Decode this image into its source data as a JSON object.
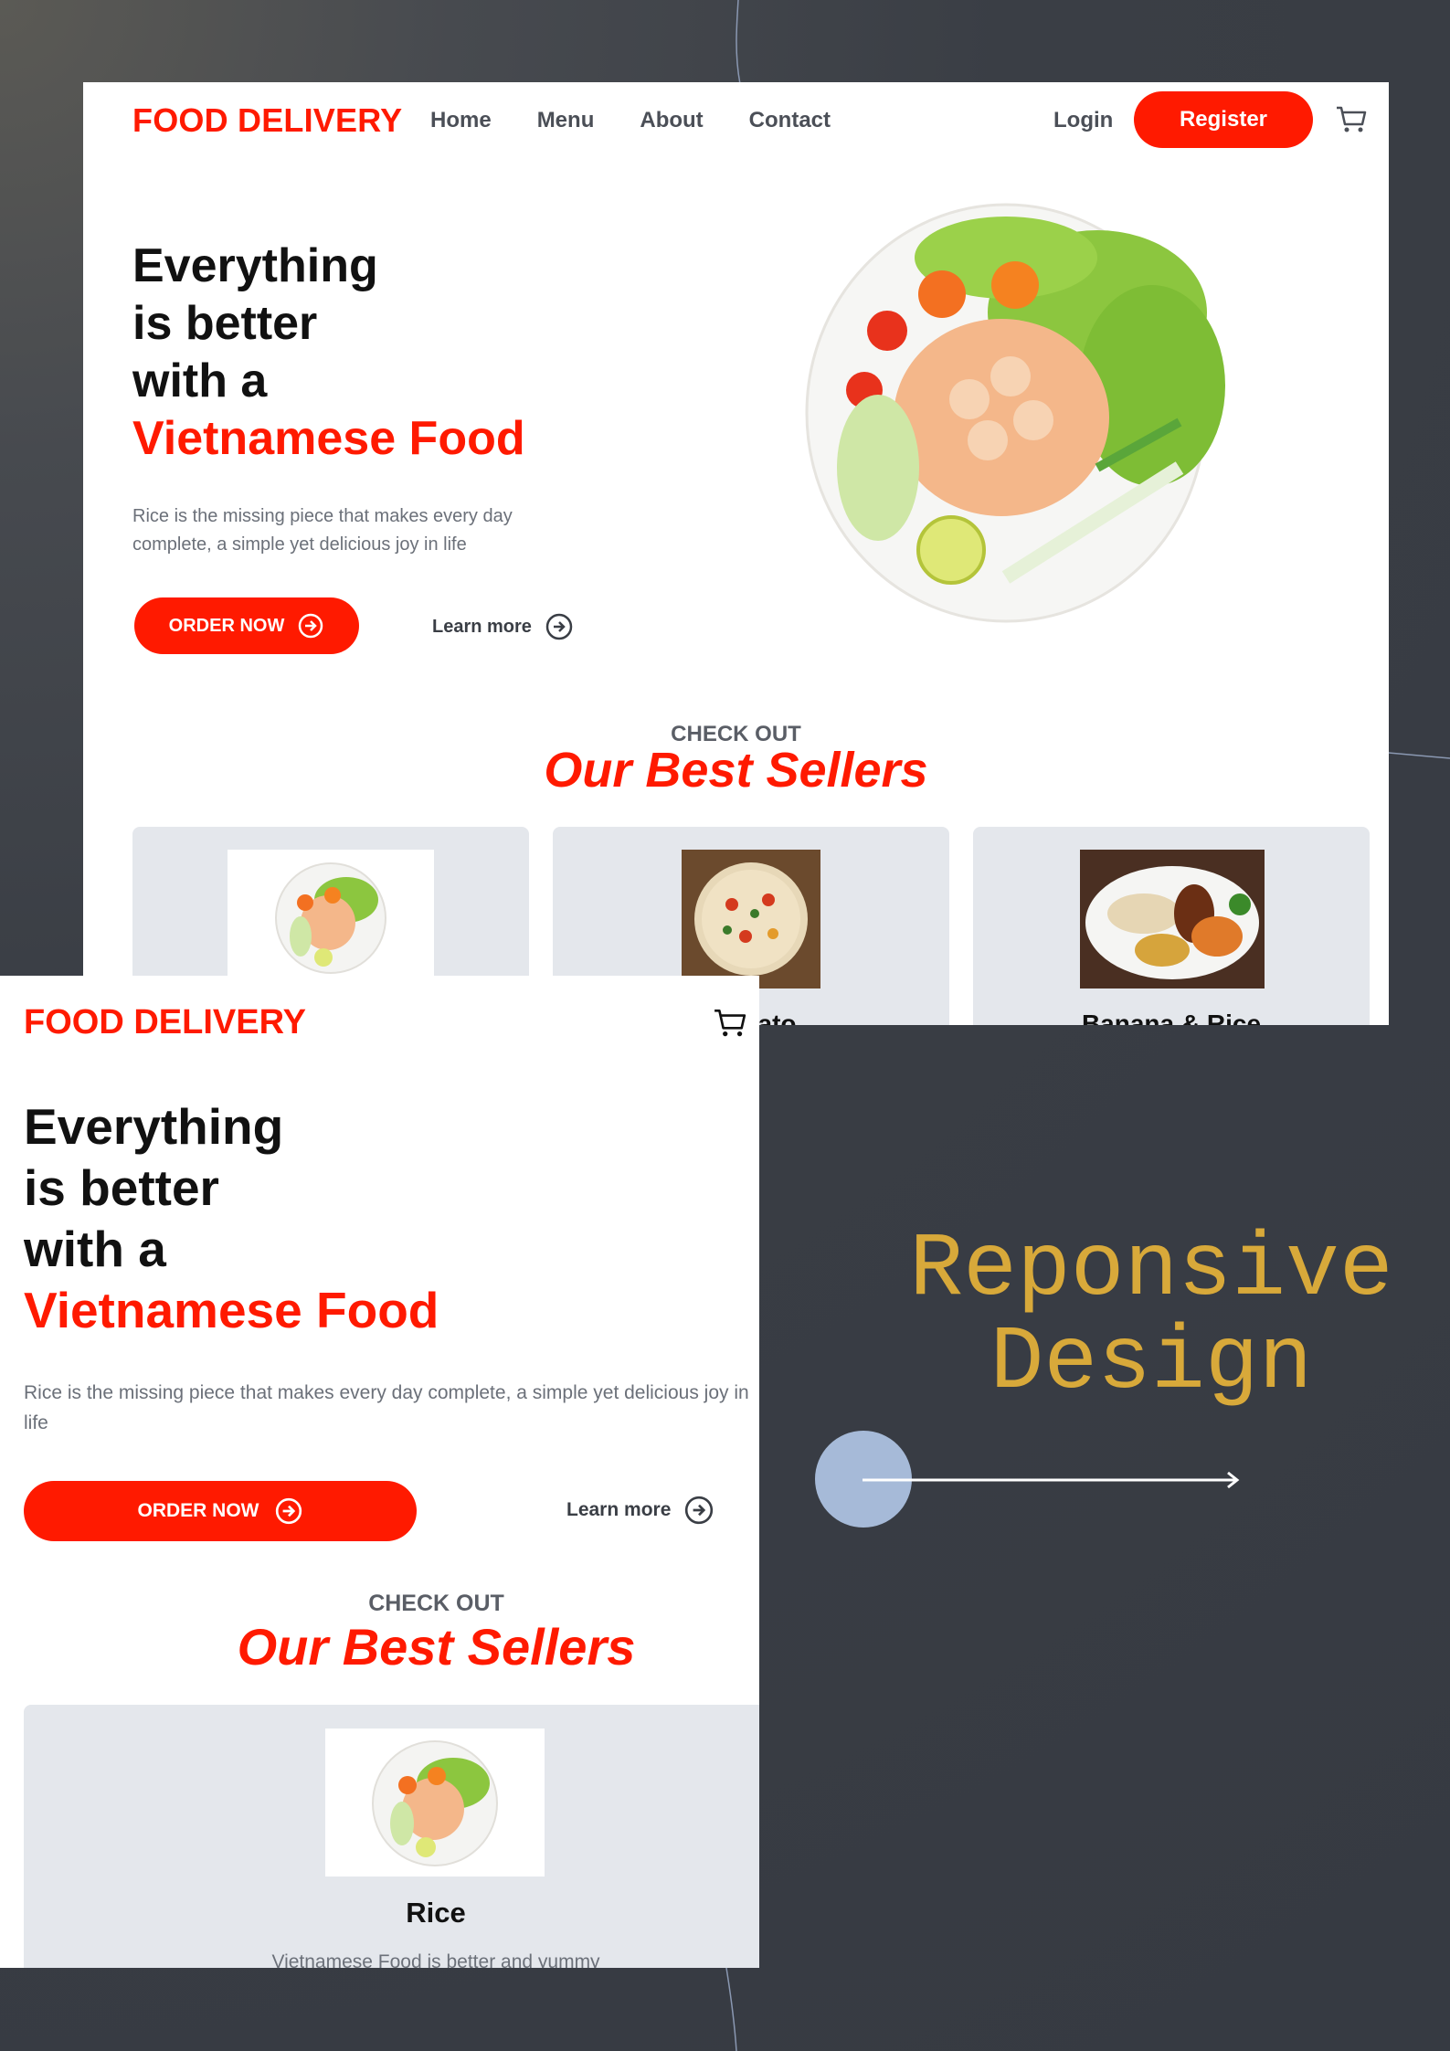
{
  "desktop": {
    "nav": {
      "logo": "FOOD DELIVERY",
      "links": [
        "Home",
        "Menu",
        "About",
        "Contact"
      ],
      "login": "Login",
      "register": "Register",
      "cart_icon": "cart-icon"
    },
    "hero": {
      "title_lines": [
        "Everything",
        "is better",
        "with a"
      ],
      "title_accent": "Vietnamese Food",
      "description": "Rice is the missing piece that makes every day complete, a simple yet delicious joy in life",
      "order_button": "ORDER NOW",
      "learn_more": "Learn more"
    },
    "best_sellers": {
      "kicker": "CHECK OUT",
      "heading": "Our Best Sellers",
      "cards": [
        {
          "title": ""
        },
        {
          "title": "Tomato"
        },
        {
          "title": "Banana & Rice"
        }
      ]
    }
  },
  "mobile": {
    "logo": "FOOD DELIVERY",
    "hero": {
      "title_lines": [
        "Everything",
        "is better",
        "with a"
      ],
      "title_accent": "Vietnamese Food",
      "description": "Rice is the missing piece that makes every day complete, a simple yet delicious joy in life",
      "order_button": "ORDER NOW",
      "learn_more": "Learn more"
    },
    "best_sellers": {
      "kicker": "CHECK OUT",
      "heading": "Our Best Sellers",
      "card": {
        "title": "Rice",
        "subtitle": "Vietnamese Food is better and yummy"
      }
    }
  },
  "showcase": {
    "title_line1": "Reponsive",
    "title_line2": "Design"
  },
  "colors": {
    "accent": "#ff1a00",
    "background": "#363a42",
    "showcase_text": "#d8a93a",
    "dot": "#a6bad8"
  }
}
